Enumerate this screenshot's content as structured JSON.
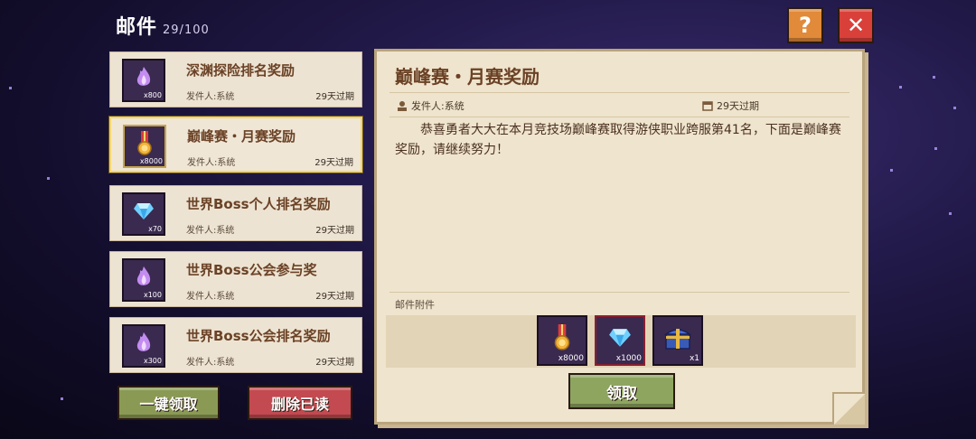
{
  "header": {
    "title": "邮件",
    "count": "29/100"
  },
  "top_buttons": {
    "help": "?",
    "close": "✕"
  },
  "mails": [
    {
      "title": "深渊探险排名奖励",
      "sender": "发件人:系统",
      "expire": "29天过期",
      "qty": "x800",
      "icon": "purple-flame-icon",
      "selected": false
    },
    {
      "title": "巅峰赛・月赛奖励",
      "sender": "发件人:系统",
      "expire": "29天过期",
      "qty": "x8000",
      "icon": "medal-icon",
      "selected": true
    },
    {
      "title": "世界Boss个人排名奖励",
      "sender": "发件人:系统",
      "expire": "29天过期",
      "qty": "x70",
      "icon": "diamond-icon",
      "selected": false
    },
    {
      "title": "世界Boss公会参与奖",
      "sender": "发件人:系统",
      "expire": "29天过期",
      "qty": "x100",
      "icon": "purple-flame-icon",
      "selected": false
    },
    {
      "title": "世界Boss公会排名奖励",
      "sender": "发件人:系统",
      "expire": "29天过期",
      "qty": "x300",
      "icon": "purple-flame-icon",
      "selected": false
    }
  ],
  "actions": {
    "claim_all": "一键领取",
    "delete_read": "删除已读"
  },
  "detail": {
    "title": "巅峰赛・月赛奖励",
    "sender": "发件人:系统",
    "expire": "29天过期",
    "body": "恭喜勇者大大在本月竞技场巅峰赛取得游侠职业跨服第41名，下面是巅峰赛奖励，请继续努力！",
    "attachments_label": "邮件附件",
    "attachments": [
      {
        "icon": "medal-icon",
        "qty": "x8000"
      },
      {
        "icon": "diamond-icon",
        "qty": "x1000"
      },
      {
        "icon": "treasure-chest-icon",
        "qty": "x1"
      }
    ],
    "claim_label": "领取"
  },
  "colors": {
    "accent_title": "#6b4226",
    "close": "#d9403a",
    "help": "#e08a3a",
    "claim": "#8ea560",
    "delete": "#c24a50"
  }
}
